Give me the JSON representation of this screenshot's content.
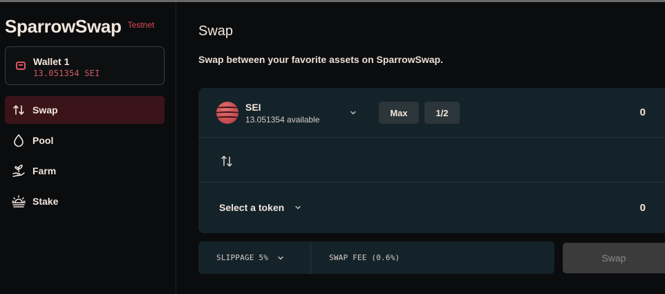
{
  "brand": {
    "name": "SparrowSwap",
    "tag": "Testnet"
  },
  "wallet": {
    "name": "Wallet 1",
    "balance": "13.051354 SEI"
  },
  "nav": [
    {
      "label": "Swap",
      "icon": "swap-arrows-icon",
      "active": true
    },
    {
      "label": "Pool",
      "icon": "droplet-icon",
      "active": false
    },
    {
      "label": "Farm",
      "icon": "sprout-hand-icon",
      "active": false
    },
    {
      "label": "Stake",
      "icon": "sunrise-icon",
      "active": false
    }
  ],
  "page": {
    "title": "Swap",
    "subtitle": "Swap between your favorite assets on SparrowSwap."
  },
  "swap": {
    "from": {
      "token": "SEI",
      "available": "13.051354 available",
      "amount": "0"
    },
    "max_label": "Max",
    "half_label": "1/2",
    "to": {
      "select_label": "Select a token",
      "amount": "0"
    },
    "slippage": "SLIPPAGE 5%",
    "swap_fee": "SWAP FEE (0.6%)",
    "button_label": "Swap"
  },
  "colors": {
    "background": "#0b0c0e",
    "card": "#142329",
    "accent": "#e24a55",
    "active_nav": "#3a1419"
  }
}
